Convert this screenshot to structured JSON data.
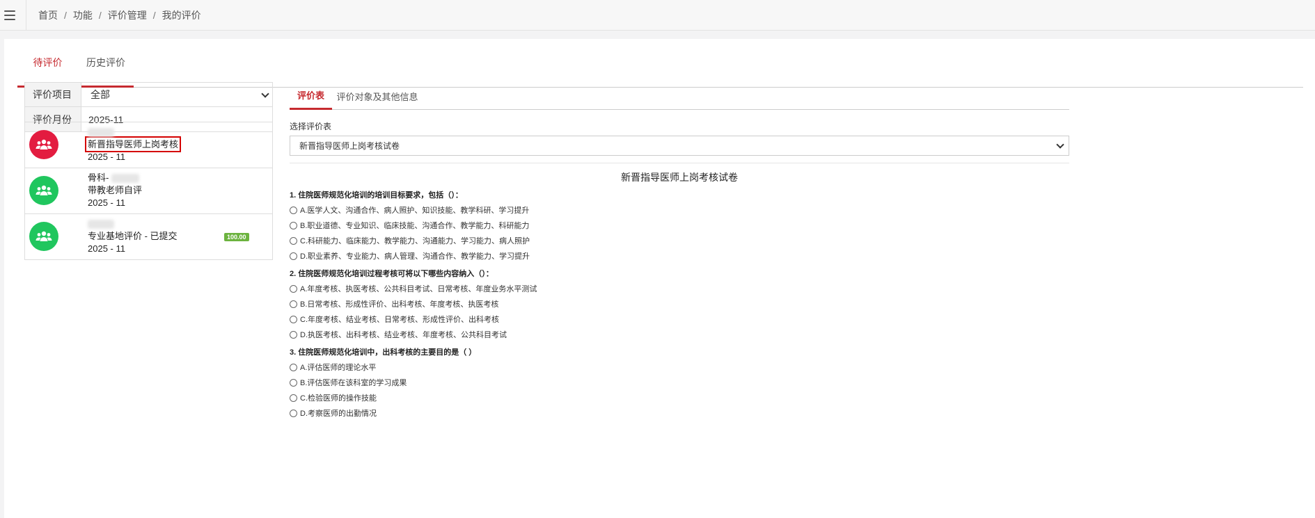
{
  "breadcrumb": [
    "首页",
    "功能",
    "评价管理",
    "我的评价"
  ],
  "tabs": {
    "pending": "待评价",
    "history": "历史评价"
  },
  "filters": {
    "project_label": "评价项目",
    "project_value": "全部",
    "month_label": "评价月份",
    "month_value": "2025-11"
  },
  "eval_items": [
    {
      "name_redacted": true,
      "title": "新晋指导医师上岗考核",
      "month": "2025 - 11",
      "color": "#e31c40",
      "highlighted": true
    },
    {
      "dept": "骨科-",
      "title": "带教老师自评",
      "month": "2025 - 11",
      "color": "#20c65e"
    },
    {
      "name_redacted": true,
      "title": "专业基地评价 - 已提交",
      "month": "2025 - 11",
      "score": "100.00",
      "color": "#20c65e"
    }
  ],
  "right_tabs": {
    "form": "评价表",
    "info": "评价对象及其他信息"
  },
  "select_label": "选择评价表",
  "select_value": "新晋指导医师上岗考核试卷",
  "form_title": "新晋指导医师上岗考核试卷",
  "questions": [
    {
      "title": "1. 住院医师规范化培训的培训目标要求，包括（）：",
      "options": [
        "A.医学人文、沟通合作、病人照护、知识技能、教学科研、学习提升",
        "B.职业道德、专业知识、临床技能、沟通合作、教学能力、科研能力",
        "C.科研能力、临床能力、教学能力、沟通能力、学习能力、病人照护",
        "D.职业素养、专业能力、病人管理、沟通合作、教学能力、学习提升"
      ]
    },
    {
      "title": "2. 住院医师规范化培训过程考核可将以下哪些内容纳入（）：",
      "options": [
        "A.年度考核、执医考核、公共科目考试、日常考核、年度业务水平测试",
        "B.日常考核、形成性评价、出科考核、年度考核、执医考核",
        "C.年度考核、结业考核、日常考核、形成性评价、出科考核",
        "D.执医考核、出科考核、结业考核、年度考核、公共科目考试"
      ]
    },
    {
      "title": "3. 住院医师规范化培训中，出科考核的主要目的是（ ）",
      "options": [
        "A.评估医师的理论水平",
        "B.评估医师在该科室的学习成果",
        "C.检验医师的操作技能",
        "D.考察医师的出勤情况"
      ]
    }
  ],
  "colors": {
    "accent": "#c62a2f",
    "red_avatar": "#e31c40",
    "green_avatar": "#20c65e",
    "score_badge": "#6cb33f"
  }
}
